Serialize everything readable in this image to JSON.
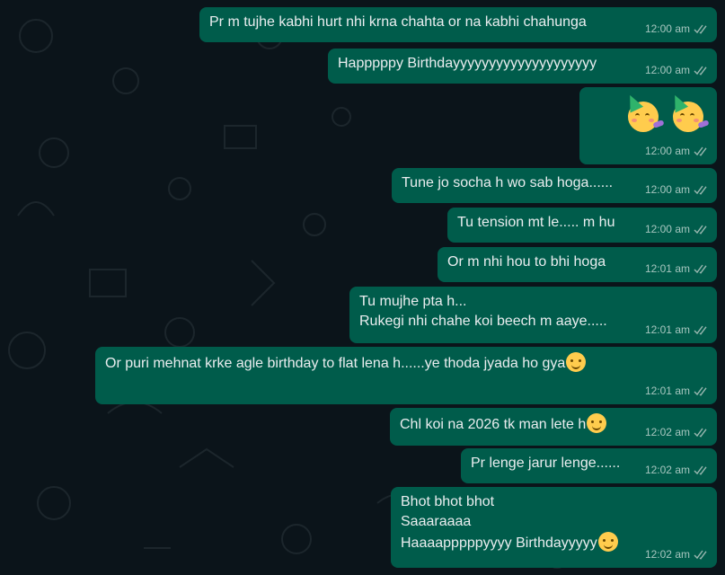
{
  "messages": [
    {
      "text": "Pr m tujhe kabhi hurt nhi krna chahta or na kabhi chahunga",
      "time": "12:00 am",
      "emoji": ""
    },
    {
      "text": "Happpppy Birthdayyyyyyyyyyyyyyyyyyyy",
      "time": "12:00 am",
      "emoji": ""
    },
    {
      "text": "",
      "time": "12:00 am",
      "emoji": "partying-face-x2"
    },
    {
      "text": "Tune jo socha h wo sab hoga......",
      "time": "12:00 am",
      "emoji": ""
    },
    {
      "text": "Tu tension mt le..... m hu",
      "time": "12:00 am",
      "emoji": ""
    },
    {
      "text": "Or m nhi hou to bhi hoga",
      "time": "12:01 am",
      "emoji": ""
    },
    {
      "text": "Tu mujhe pta h...\n Rukegi nhi chahe koi beech m aaye.....",
      "time": "12:01 am",
      "emoji": ""
    },
    {
      "text": "Or puri mehnat krke agle birthday to flat lena h......ye thoda jyada ho gya",
      "time": "12:01 am",
      "emoji": "grinning-sweat-face"
    },
    {
      "text": "Chl koi na 2026 tk man lete h",
      "time": "12:02 am",
      "emoji": "smiling-face"
    },
    {
      "text": "Pr lenge jarur lenge......",
      "time": "12:02 am",
      "emoji": ""
    },
    {
      "text": "Bhot bhot bhot\nSaaaraaaa\nHaaaapppppyyyy Birthdayyyyy",
      "time": "12:02 am",
      "emoji": "smiling-face"
    }
  ],
  "colors": {
    "background": "#0b141a",
    "outgoing_bubble": "#005c4b",
    "text": "#e9edef",
    "meta": "#a6c6bf",
    "tick_read": "#9bb8b1"
  },
  "icons": {
    "status": "double-check-icon"
  }
}
